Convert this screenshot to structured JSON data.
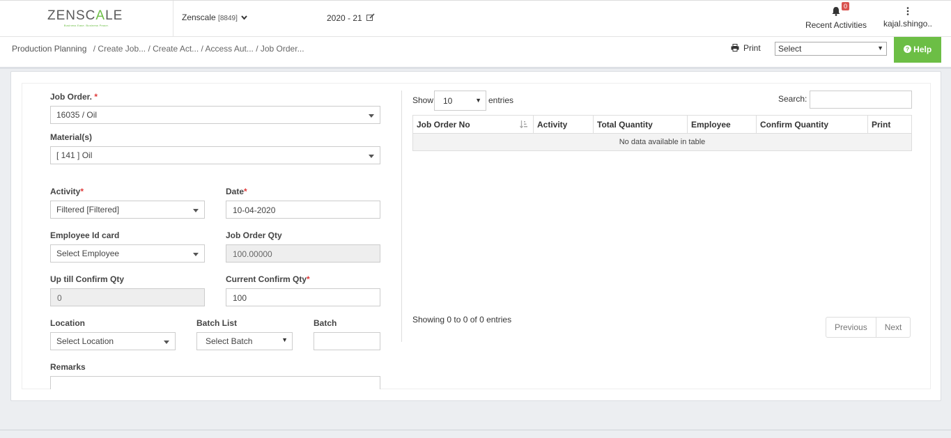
{
  "header": {
    "logo_text": "ZENSCALE",
    "logo_tagline": "Business Ease. Business Peace.",
    "company_name": "Zenscale",
    "company_code": "[8849]",
    "fiscal_year": "2020 - 21",
    "notification_count": "0",
    "recent_label": "Recent Activities",
    "user_label": "kajal.shingo.."
  },
  "breadcrumb": {
    "root": "Production Planning",
    "trail": "/ Create Job... / Create Act... / Access Aut... / Job Order..."
  },
  "toolbar": {
    "print_label": "Print",
    "select_value": "Select",
    "help_label": "Help"
  },
  "form": {
    "job_order": {
      "label": "Job Order.",
      "value": "16035 / Oil"
    },
    "materials": {
      "label": "Material(s)",
      "value": "[ 141 ] Oil"
    },
    "activity": {
      "label": "Activity",
      "value": "Filtered [Filtered]"
    },
    "date": {
      "label": "Date",
      "value": "10-04-2020"
    },
    "employee": {
      "label": "Employee Id card",
      "value": "Select Employee"
    },
    "job_order_qty": {
      "label": "Job Order Qty",
      "value": "100.00000"
    },
    "uptill_confirm_qty": {
      "label": "Up till Confirm Qty",
      "value": "0"
    },
    "current_confirm_qty": {
      "label": "Current Confirm Qty",
      "value": "100"
    },
    "location": {
      "label": "Location",
      "value": "Select Location"
    },
    "batch_list": {
      "label": "Batch List",
      "value": "Select Batch"
    },
    "batch": {
      "label": "Batch",
      "value": ""
    },
    "remarks": {
      "label": "Remarks",
      "value": ""
    },
    "required_mark": "*"
  },
  "table": {
    "show_label": "Show",
    "page_length": "10",
    "entries_label": "entries",
    "search_label": "Search:",
    "columns": [
      "Job Order No",
      "Activity",
      "Total Quantity",
      "Employee",
      "Confirm Quantity",
      "Print"
    ],
    "empty_message": "No data available in table",
    "info": "Showing 0 to 0 of 0 entries",
    "prev_label": "Previous",
    "next_label": "Next"
  }
}
